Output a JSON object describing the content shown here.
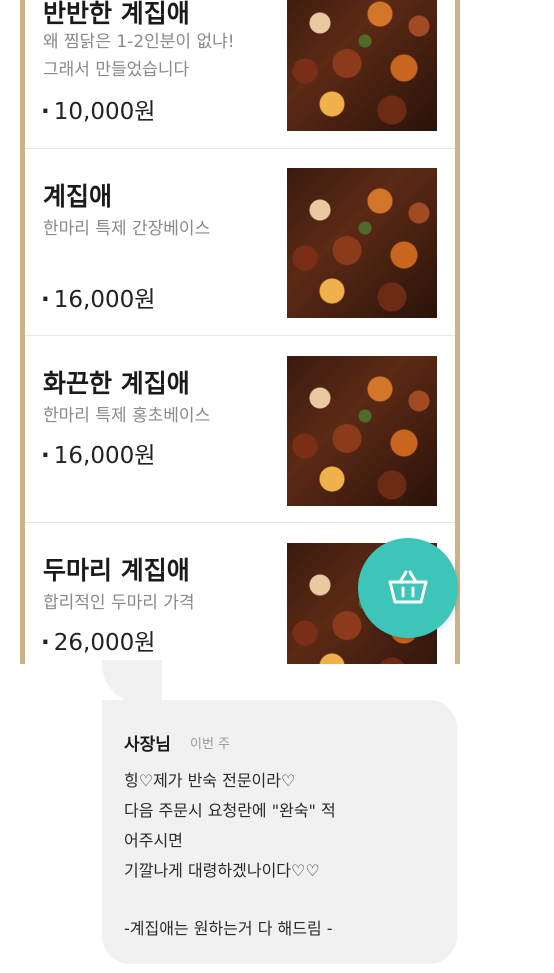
{
  "menu": {
    "items": [
      {
        "name": "반반한 계집애",
        "description": "왜 찜닭은 1-2인분이 없냐!\n그래서 만들었습니다",
        "price": "10,000원"
      },
      {
        "name": "계집애",
        "description": "한마리 특제 간장베이스",
        "price": "16,000원"
      },
      {
        "name": "화끈한 계집애",
        "description": "한마리 특제 홍초베이스",
        "price": "16,000원"
      },
      {
        "name": "두마리 계집애",
        "description": "합리적인 두마리 가격",
        "price": "26,000원"
      }
    ],
    "price_bullet": "·",
    "cart_icon": "basket-icon",
    "accent_color": "#3cc5b8",
    "frame_color": "#c9b48a"
  },
  "chat": {
    "sender": "사장님",
    "time": "이번 주",
    "message": "힝♡제가 반숙 전문이라♡\n다음 주문시 요청란에 \"완숙\" 적\n어주시면\n기깔나게 대령하겠나이다♡♡",
    "signature": "-계집애는 원하는거 다 해드림 -"
  }
}
